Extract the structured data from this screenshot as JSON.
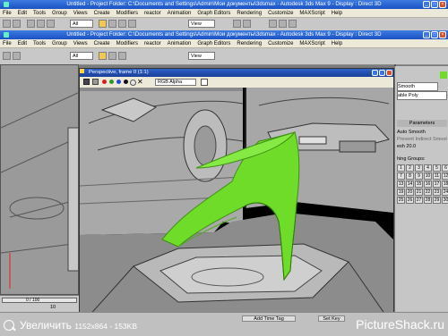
{
  "title_bar_1": {
    "text": "Untitled - Project Folder: C:\\Documents and Settings\\Admin\\Мои документы\\3dsmax - Autodesk 3ds Max 9 - Display : Direct 3D"
  },
  "title_bar_2": {
    "text": "Untitled - Project Folder: C:\\Documents and Settings\\Admin\\Мои документы\\3dsmax - Autodesk 3ds Max 9 - Display : Direct 3D"
  },
  "menu": [
    "File",
    "Edit",
    "Tools",
    "Group",
    "Views",
    "Create",
    "Modifiers",
    "reactor",
    "Animation",
    "Graph Editors",
    "Rendering",
    "Customize",
    "MAXScript",
    "Help"
  ],
  "toolbar": {
    "filter": "All",
    "view": "View"
  },
  "frame_window": {
    "title": "Perspective, frame 0 (1:1)",
    "channel": "RGB Alpha",
    "swatches": [
      "#d62020",
      "#2a9a2a",
      "#2448d8",
      "#e6e6e6"
    ]
  },
  "right_panel": {
    "items": [
      "Smooth",
      "able Poly",
      "Parameters",
      "Auto Smooth",
      "Prevent Indirect Smoothing",
      "esh 20.0",
      "hing Groups:"
    ],
    "smoothing_groups": [
      "1",
      "2",
      "3",
      "4",
      "5",
      "6",
      "7",
      "8",
      "9",
      "10",
      "11",
      "12",
      "13",
      "14",
      "15",
      "16",
      "17",
      "18",
      "19",
      "20",
      "21",
      "22",
      "23",
      "24",
      "25",
      "26",
      "27",
      "28",
      "29",
      "30",
      "31",
      "32"
    ]
  },
  "timeline": {
    "frame": "0 / 100",
    "tick": "10"
  },
  "status": {
    "add_time_tag": "Add Time Tag",
    "set_key": "Set Key"
  },
  "watermark": {
    "left": "Увеличить",
    "size": "1152x864 - 153KB",
    "right": "PictureShack.ru"
  },
  "colors": {
    "accent_green": "#6fdc2a",
    "titlebar_blue": "#2e62c8"
  },
  "icons": [
    "select-icon",
    "move-icon",
    "rotate-icon",
    "scale-icon",
    "save-icon",
    "copy-icon",
    "clear-icon",
    "close-icon"
  ]
}
